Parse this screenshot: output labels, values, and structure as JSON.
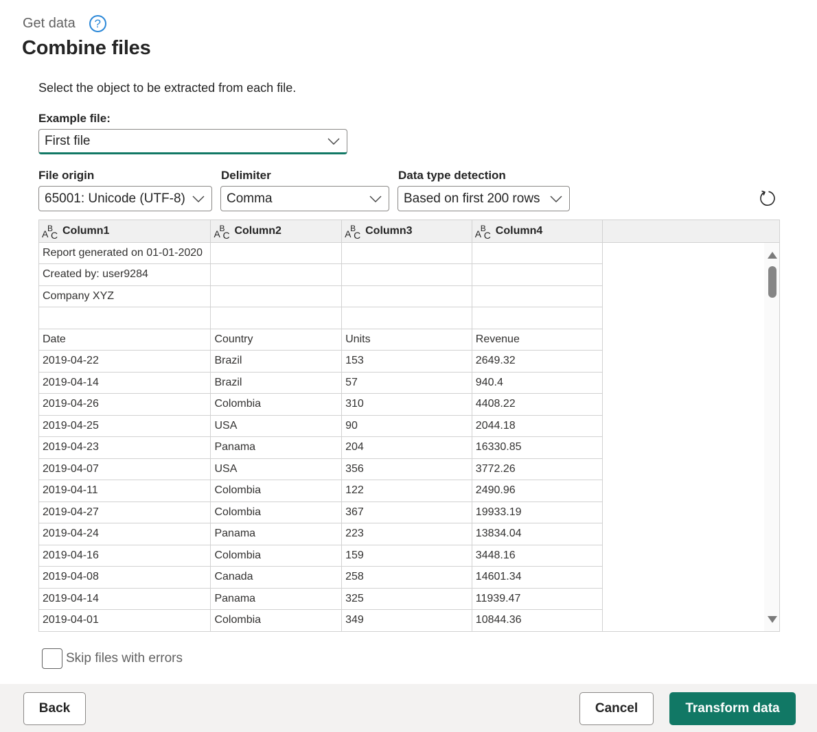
{
  "header": {
    "eyebrow": "Get data",
    "help_icon": "?",
    "title": "Combine files"
  },
  "instruction": "Select the object to be extracted from each file.",
  "example_file": {
    "label": "Example file:",
    "value": "First file"
  },
  "file_origin": {
    "label": "File origin",
    "value": "65001: Unicode (UTF-8)"
  },
  "delimiter": {
    "label": "Delimiter",
    "value": "Comma"
  },
  "data_type_detection": {
    "label": "Data type detection",
    "value": "Based on first 200 rows"
  },
  "preview": {
    "columns": [
      {
        "type_icon": "text-type-icon",
        "name": "Column1"
      },
      {
        "type_icon": "text-type-icon",
        "name": "Column2"
      },
      {
        "type_icon": "text-type-icon",
        "name": "Column3"
      },
      {
        "type_icon": "text-type-icon",
        "name": "Column4"
      }
    ],
    "rows": [
      [
        "Report generated on 01-01-2020",
        "",
        "",
        ""
      ],
      [
        "Created by: user9284",
        "",
        "",
        ""
      ],
      [
        "Company XYZ",
        "",
        "",
        ""
      ],
      [
        "",
        "",
        "",
        ""
      ],
      [
        "Date",
        "Country",
        "Units",
        "Revenue"
      ],
      [
        "2019-04-22",
        "Brazil",
        "153",
        "2649.32"
      ],
      [
        "2019-04-14",
        "Brazil",
        "57",
        "940.4"
      ],
      [
        "2019-04-26",
        "Colombia",
        "310",
        "4408.22"
      ],
      [
        "2019-04-25",
        "USA",
        "90",
        "2044.18"
      ],
      [
        "2019-04-23",
        "Panama",
        "204",
        "16330.85"
      ],
      [
        "2019-04-07",
        "USA",
        "356",
        "3772.26"
      ],
      [
        "2019-04-11",
        "Colombia",
        "122",
        "2490.96"
      ],
      [
        "2019-04-27",
        "Colombia",
        "367",
        "19933.19"
      ],
      [
        "2019-04-24",
        "Panama",
        "223",
        "13834.04"
      ],
      [
        "2019-04-16",
        "Colombia",
        "159",
        "3448.16"
      ],
      [
        "2019-04-08",
        "Canada",
        "258",
        "14601.34"
      ],
      [
        "2019-04-14",
        "Panama",
        "325",
        "11939.47"
      ],
      [
        "2019-04-01",
        "Colombia",
        "349",
        "10844.36"
      ],
      [
        "",
        "",
        "",
        ""
      ]
    ]
  },
  "skip_errors": {
    "label": "Skip files with errors",
    "checked": false
  },
  "footer": {
    "back_label": "Back",
    "cancel_label": "Cancel",
    "transform_label": "Transform data"
  },
  "colors": {
    "accent": "#117865",
    "help": "#2b88d8",
    "footer_bg": "#f3f2f1",
    "header_bg": "#f0f0f0"
  }
}
